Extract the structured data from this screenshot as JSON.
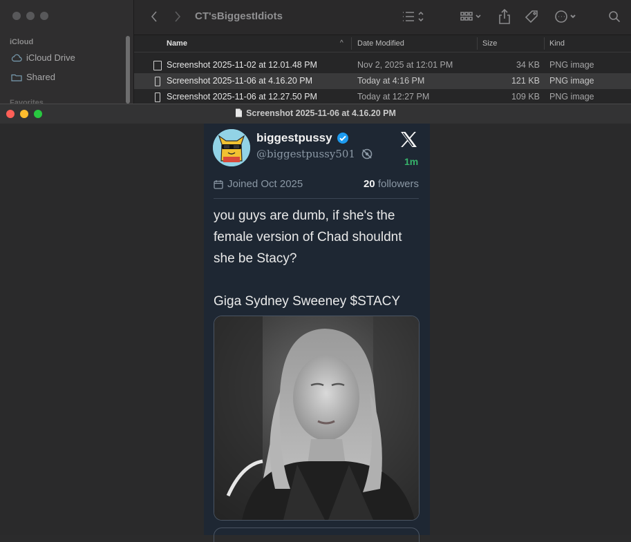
{
  "finder": {
    "title": "CT'sBiggestIdiots",
    "sidebar": {
      "section_icloud": "iCloud",
      "items": [
        {
          "label": "iCloud Drive",
          "icon": "cloud-icon"
        },
        {
          "label": "Shared",
          "icon": "shared-folder-icon"
        }
      ],
      "section_favorites": "Favorites"
    },
    "columns": {
      "name": "Name",
      "date": "Date Modified",
      "size": "Size",
      "kind": "Kind"
    },
    "files": [
      {
        "name": "Screenshot 2025-11-02 at 12.01.48 PM",
        "date": "Nov 2, 2025 at 12:01 PM",
        "size": "34 KB",
        "kind": "PNG image",
        "selected": false
      },
      {
        "name": "Screenshot 2025-11-06 at 4.16.20 PM",
        "date": "Today at 4:16 PM",
        "size": "121 KB",
        "kind": "PNG image",
        "selected": true
      },
      {
        "name": "Screenshot 2025-11-06 at 12.27.50 PM",
        "date": "Today at 12:27 PM",
        "size": "109 KB",
        "kind": "PNG image",
        "selected": false
      }
    ]
  },
  "preview": {
    "title": "Screenshot 2025-11-06 at 4.16.20 PM",
    "colors": {
      "close": "#fe5f57",
      "minimize": "#febc2e",
      "zoom": "#28c840"
    }
  },
  "tweet": {
    "username": "biggestpussy",
    "handle": "@biggestpussy501",
    "time": "1m",
    "joined": "Joined Oct 2025",
    "followers_count": "20",
    "followers_label": "followers",
    "text_lines": [
      "you guys are dumb, if she's the",
      "female version of Chad shouldnt",
      "she be Stacy?",
      "",
      "Giga Sydney Sweeney $STACY"
    ],
    "colors": {
      "card_bg": "#1e2733",
      "time": "#37b36b",
      "verified": "#1d9bf0"
    }
  }
}
